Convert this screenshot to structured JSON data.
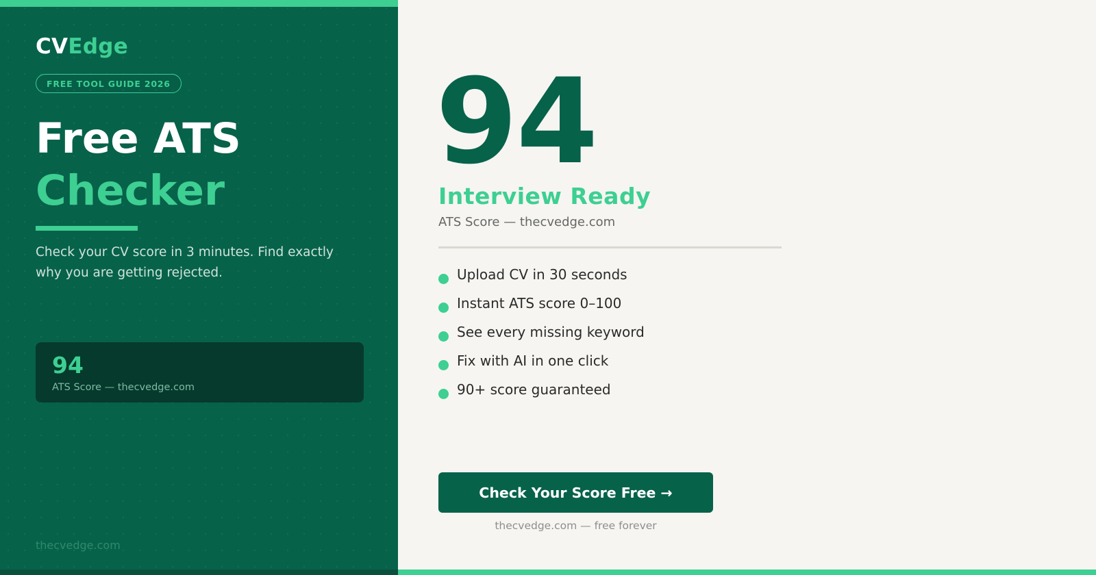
{
  "colors": {
    "brand_green": "#07624a",
    "accent": "#3ecf92",
    "card_dark": "#053a2c",
    "page_bg": "#f6f5f1"
  },
  "brand": {
    "part1": "CV",
    "part2": "Edge"
  },
  "badge": "FREE TOOL GUIDE 2026",
  "hero": {
    "title_line1": "Free ATS",
    "title_line2": "Checker",
    "description": "Check your CV score in 3 minutes. Find exactly why you are getting rejected."
  },
  "score_card": {
    "score": "94",
    "label": "ATS Score — thecvedge.com"
  },
  "left_footer": "thecvedge.com",
  "result": {
    "score": "94",
    "status": "Interview Ready",
    "label": "ATS Score — thecvedge.com"
  },
  "features": [
    "Upload CV in 30 seconds",
    "Instant ATS score 0–100",
    "See every missing keyword",
    "Fix with AI in one click",
    "90+ score guaranteed"
  ],
  "cta": {
    "label": "Check Your Score Free →",
    "subtext": "thecvedge.com — free forever"
  }
}
